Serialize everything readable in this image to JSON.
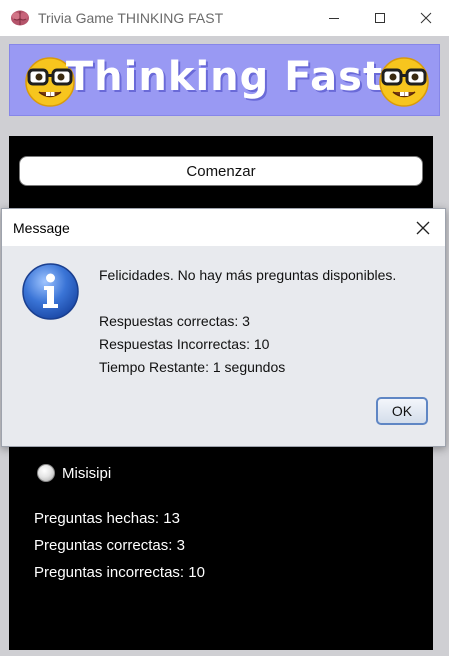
{
  "window": {
    "title": "Trivia Game THINKING FAST",
    "icon": "brain-icon",
    "controls": [
      "minimize-icon",
      "maximize-icon",
      "close-icon"
    ]
  },
  "banner": {
    "title": "Thinking Fast",
    "background": "#9999f3",
    "icons": [
      "nerd-face-emoji",
      "nerd-face-emoji"
    ]
  },
  "game": {
    "start_label": "Comenzar",
    "option_label": "Misisipi",
    "stats": {
      "asked": "Preguntas hechas:  13",
      "correct": "Preguntas correctas:  3",
      "incorrect": "Preguntas incorrectas:  10"
    }
  },
  "dialog": {
    "title": "Message",
    "icon": "info-icon",
    "lines": [
      "Felicidades. No hay más preguntas disponibles.",
      "Respuestas correctas: 3",
      "Respuestas Incorrectas: 10",
      "Tiempo Restante: 1 segundos"
    ],
    "ok_label": "OK",
    "accent": "#5f86c4"
  }
}
